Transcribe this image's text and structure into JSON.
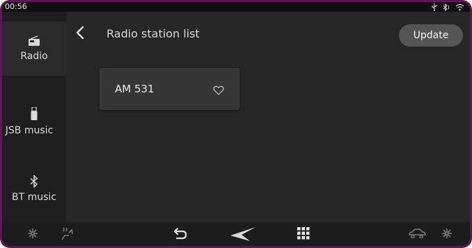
{
  "status_bar": {
    "time": "00:56",
    "icons": [
      "usb-icon",
      "bluetooth-icon",
      "wifi-icon"
    ]
  },
  "sidebar": {
    "items": [
      {
        "label": "Radio",
        "icon": "radio-icon",
        "active": true
      },
      {
        "label": "JSB music",
        "icon": "usb-stick-icon",
        "active": false
      },
      {
        "label": "BT music",
        "icon": "bluetooth-icon",
        "active": false
      }
    ]
  },
  "header": {
    "title": "Radio station list",
    "update_label": "Update",
    "back_icon": "chevron-left-icon"
  },
  "stations": [
    {
      "name": "AM 531",
      "favorite": false,
      "icon": "heart-outline-icon"
    }
  ],
  "bottom_bar": {
    "icons": [
      "fan-icon",
      "seat-heat-icon",
      "return-icon",
      "nav-arrow-icon",
      "apps-grid-icon",
      "car-icon",
      "fan-icon"
    ]
  },
  "colors": {
    "frame": "#5a1a4f",
    "background": "#262626",
    "button": "#555555",
    "text": "#e8e8e8"
  }
}
